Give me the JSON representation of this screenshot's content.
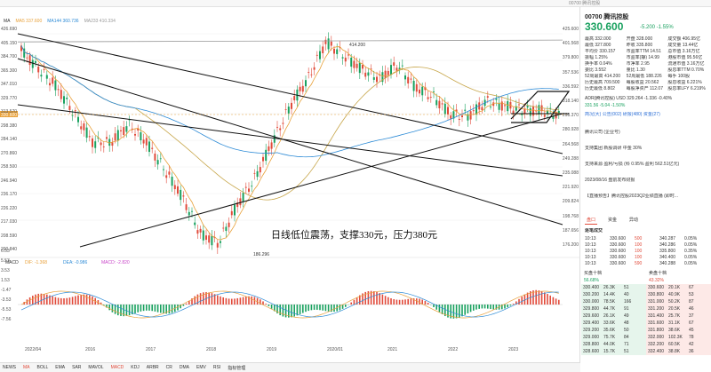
{
  "topbar": {
    "text": "00700 腾讯控股"
  },
  "ma_legend": [
    {
      "label": "MA",
      "color": "#333"
    },
    {
      "label": "MA5 337.600",
      "color": "#e8a13a"
    },
    {
      "label": "MA144 360.736",
      "color": "#2d8bd6"
    },
    {
      "label": "MA233 410.334",
      "color": "#999999"
    }
  ],
  "price_axis_left": [
    "426.690",
    "405.150",
    "384.700",
    "365.300",
    "347.010",
    "329.770",
    "313.570",
    "298.380",
    "284.140",
    "270.860",
    "258.500",
    "246.940",
    "236.170",
    "226.220",
    "217.030",
    "208.590",
    "200.840"
  ],
  "price_axis_right": [
    "425.600",
    "401.568",
    "379.800",
    "357.536",
    "336.592",
    "318.140",
    "298.370",
    "280.928",
    "264.568",
    "249.288",
    "235.088",
    "221.920",
    "209.824",
    "198.768",
    "187.656",
    "176.200"
  ],
  "current_price_tag": "330.600",
  "high_label": "414.200",
  "low_label": "186.296",
  "annotation": "日线低位震荡，支撑330元，压力380元",
  "macd_legend": [
    {
      "label": "MACD",
      "color": "#333"
    },
    {
      "label": "DIF: -1.368",
      "color": "#e8a13a"
    },
    {
      "label": "DEA: -0.986",
      "color": "#2d8bd6"
    },
    {
      "label": "MACD: -2.820",
      "color": "#c844c8"
    }
  ],
  "macd_axis": [
    "6.53",
    "5.53",
    "3.53",
    "1.53",
    "-1.47",
    "-3.53",
    "-5.53",
    "-7.56"
  ],
  "year_labels": [
    "2022/04",
    "2016",
    "2017",
    "2018",
    "2019",
    "2020/01",
    "2021",
    "2022",
    "2023"
  ],
  "bottom_tabs": [
    "NEWS",
    "MA",
    "BOLL",
    "EMA",
    "SAR",
    "MAVOL",
    "MACD",
    "KDJ",
    "ARBR",
    "CR",
    "DMA",
    "EMV",
    "RSI",
    "指标管理"
  ],
  "right": {
    "code": "00700 腾讯控股",
    "price": "330.600",
    "change": "-5.200 -1.55%",
    "quote_rows": [
      [
        "最高 332.000",
        "开盘 328.000",
        "成交额 406.95亿"
      ],
      [
        "最低 327.800",
        "昨收 335.800",
        "成交量 13.44亿"
      ],
      [
        "平均价 330.157",
        "市盈率TTM 14.51",
        "总市值 3.16万亿"
      ],
      [
        "振幅 1.25%",
        "市盈率(静) 14.99",
        "港股市值 95.56亿"
      ],
      [
        "换手率 0.04%",
        "市净率 2.95",
        "流通市值 3.16万亿"
      ],
      [
        "委比 3.552",
        "量比 1.30",
        "股息率TTM 0.70%"
      ],
      [
        "52周最高 414.200",
        "52周最低 188.226",
        "每手 100股"
      ],
      [
        "历史最高 709.500",
        "每股收益 20.562",
        "股息收益 6.221%"
      ],
      [
        "历史最低 8.802",
        "每股净资产 112.07",
        "股息率LFY 6.219%"
      ]
    ],
    "adr": "ADR(腾讯控股) USD  329.264  -1.336 -0.40%",
    "adr2": "331.56  -5.04  -1.50%",
    "links": "简况(大)  公告(002)  研报(480)  资金(27)",
    "news": [
      "腾讯公司 (企业号)",
      "支持集团 新股调研 中金 30%",
      "支持来源 盈利/亏损 (科 0.95% 盈利 562.51亿元)",
      "2023/08/16  盘前发布财报",
      "【直播预告】腾讯控股2023Q2业绩直播 (即时..."
    ],
    "tabs": [
      "盘口",
      "资金",
      "异动"
    ],
    "trade_title": "逐笔成交",
    "trades": [
      [
        "10:13",
        "330.600",
        "500",
        "340.287",
        "0.05%"
      ],
      [
        "10:13",
        "330.600",
        "100",
        "340.286",
        "0.05%"
      ],
      [
        "10:13",
        "330.600",
        "100",
        "335.800",
        "0.35%"
      ],
      [
        "10:13",
        "330.600",
        "100",
        "340.400",
        "0.05%"
      ],
      [
        "10:13",
        "330.600",
        "590",
        "340.288",
        "0.05%"
      ]
    ],
    "ob_header": [
      "买盘十档",
      "卖盘十档"
    ],
    "ob_ratio": [
      "56.68%",
      "43.32%"
    ],
    "orderbook": [
      [
        "330.400",
        "26.3K",
        "51",
        "330.600",
        "20.1K",
        "67"
      ],
      [
        "330.200",
        "14.4K",
        "40",
        "330.800",
        "40.9K",
        "53"
      ],
      [
        "330.000",
        "78.5K",
        "166",
        "331.000",
        "50.2K",
        "87"
      ],
      [
        "329.800",
        "44.7K",
        "91",
        "331.200",
        "20.5K",
        "46"
      ],
      [
        "329.600",
        "26.1K",
        "49",
        "331.400",
        "25.7K",
        "37"
      ],
      [
        "329.400",
        "33.6K",
        "48",
        "331.600",
        "31.1K",
        "67"
      ],
      [
        "329.200",
        "35.6K",
        "50",
        "331.800",
        "38.6K",
        "45"
      ],
      [
        "329.000",
        "75.7K",
        "84",
        "332.000",
        "102.3K",
        "78"
      ],
      [
        "328.800",
        "44.0K",
        "71",
        "332.200",
        "60.5K",
        "42"
      ],
      [
        "328.600",
        "15.7K",
        "51",
        "332.400",
        "38.8K",
        "36"
      ]
    ]
  }
}
